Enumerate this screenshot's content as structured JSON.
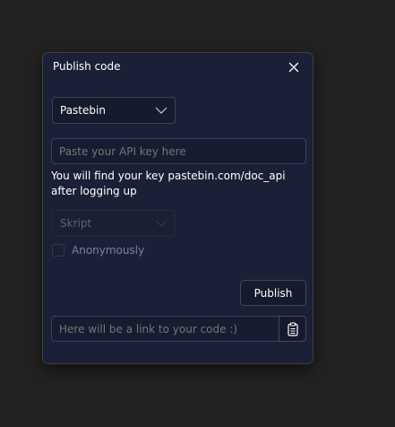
{
  "dialog": {
    "title": "Publish code",
    "close_icon": "close-icon"
  },
  "provider_select": {
    "selected": "Pastebin",
    "icon": "chevron-down-icon"
  },
  "api_key_input": {
    "value": "",
    "placeholder": "Paste your API key here"
  },
  "hint": {
    "text": "You will find your key pastebin.com/doc_api after logging up"
  },
  "syntax_select": {
    "selected": "Skript",
    "icon": "chevron-down-icon",
    "disabled": true
  },
  "anonymous_checkbox": {
    "label": "Anonymously",
    "checked": false,
    "disabled": true
  },
  "publish_button": {
    "label": "Publish"
  },
  "link_field": {
    "value": "",
    "placeholder": "Here will be a link to your code :)"
  },
  "copy_button": {
    "icon": "clipboard-icon"
  },
  "colors": {
    "background": "#222222",
    "dialog": "#1b2036",
    "border": "#3b4056",
    "text": "#ffffff",
    "muted_text": "#7b8094"
  }
}
